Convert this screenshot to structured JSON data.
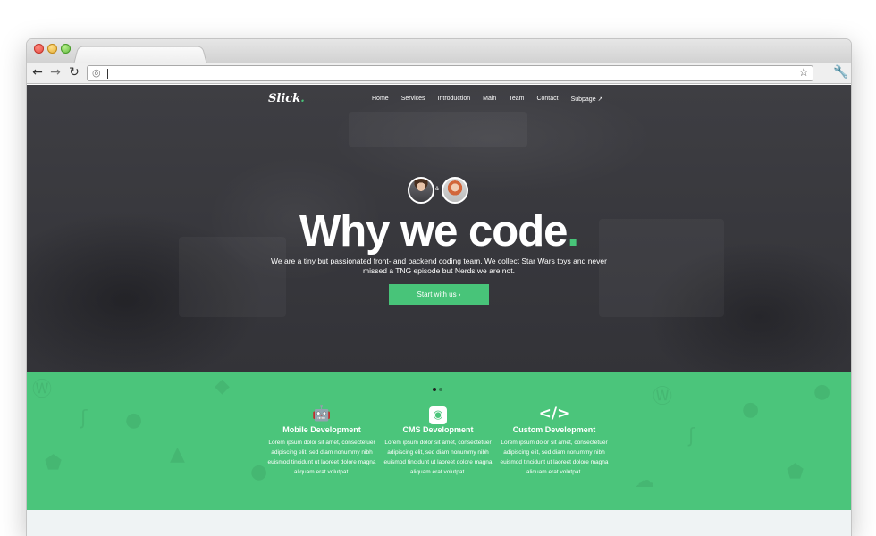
{
  "browser": {
    "back_icon": "arrow-left-icon",
    "forward_icon": "arrow-right-icon",
    "reload_icon": "reload-icon",
    "url_value": "",
    "bookmark_icon": "star-icon",
    "settings_icon": "wrench-icon"
  },
  "site": {
    "logo_text": "Slick",
    "logo_dot": ".",
    "nav": [
      "Home",
      "Services",
      "Introduction",
      "Main",
      "Team",
      "Contact",
      "Subpage"
    ],
    "nav_ext_icon": "external-link-icon"
  },
  "hero": {
    "amp": "&",
    "title": "Why we code",
    "title_dot": ".",
    "text_line1": "We are a tiny but passionated front- and backend coding team. We collect Star Wars toys and never",
    "text_line2": "missed a TNG episode but Nerds we are not.",
    "cta_label": "Start with us ›"
  },
  "features": [
    {
      "icon": "android-icon",
      "title": "Mobile Development",
      "text": "Lorem ipsum dolor sit amet, consectetuer adipiscing elit, sed diam nonummy nibh euismod tincidunt ut laoreet dolore magna aliquam erat volutpat."
    },
    {
      "icon": "github-icon",
      "title": "CMS Development",
      "text": "Lorem ipsum dolor sit amet, consectetuer adipiscing elit, sed diam nonummy nibh euismod tincidunt ut laoreet dolore magna aliquam erat volutpat."
    },
    {
      "icon": "code-icon",
      "title": "Custom Development",
      "text": "Lorem ipsum dolor sit amet, consectetuer adipiscing elit, sed diam nonummy nibh euismod tincidunt ut laoreet dolore magna aliquam erat volutpat."
    }
  ],
  "colors": {
    "accent": "#48c479",
    "hero_bg": "#3a3a3f",
    "features_bg": "#4bc57b"
  }
}
